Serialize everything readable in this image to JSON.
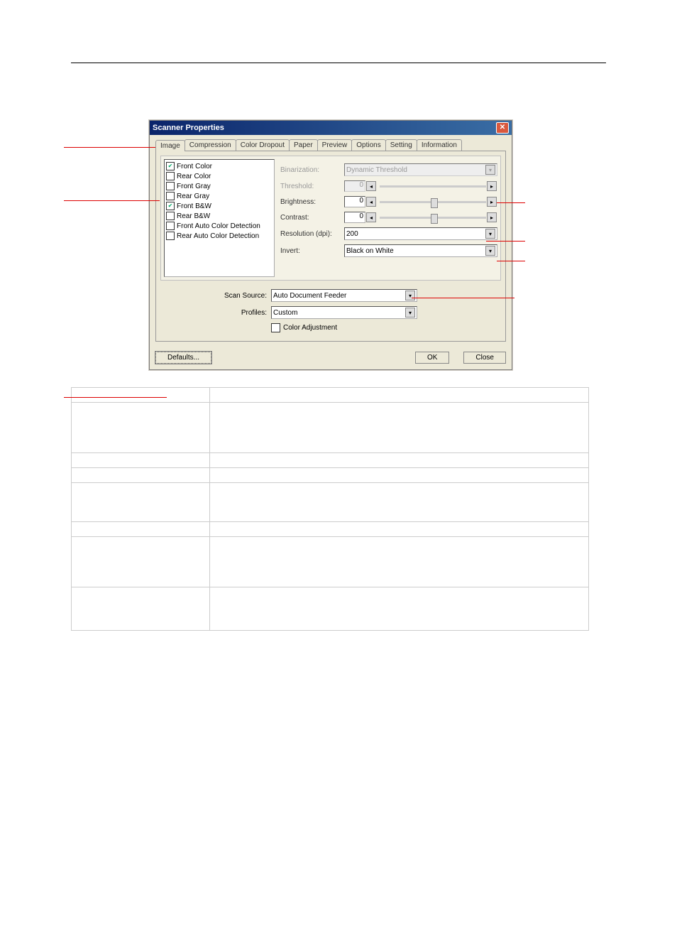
{
  "dialog": {
    "title": "Scanner Properties",
    "tabs": [
      "Image",
      "Compression",
      "Color Dropout",
      "Paper",
      "Preview",
      "Options",
      "Setting",
      "Information"
    ],
    "active_tab": 0,
    "image_list": [
      {
        "label": "Front Color",
        "checked": true
      },
      {
        "label": "Rear Color",
        "checked": false
      },
      {
        "label": "Front Gray",
        "checked": false
      },
      {
        "label": "Rear Gray",
        "checked": false
      },
      {
        "label": "Front B&W",
        "checked": true
      },
      {
        "label": "Rear B&W",
        "checked": false
      },
      {
        "label": "Front Auto Color Detection",
        "checked": false
      },
      {
        "label": "Rear Auto Color Detection",
        "checked": false
      }
    ],
    "settings": {
      "binarization_label": "Binarization:",
      "binarization_value": "Dynamic Threshold",
      "threshold_label": "Threshold:",
      "threshold_value": "0",
      "brightness_label": "Brightness:",
      "brightness_value": "0",
      "contrast_label": "Contrast:",
      "contrast_value": "0",
      "resolution_label": "Resolution (dpi):",
      "resolution_value": "200",
      "invert_label": "Invert:",
      "invert_value": "Black on White"
    },
    "scan_source_label": "Scan Source:",
    "scan_source_value": "Auto Document Feeder",
    "profiles_label": "Profiles:",
    "profiles_value": "Custom",
    "color_adjustment_label": "Color Adjustment",
    "defaults_btn": "Defaults...",
    "ok_btn": "OK",
    "close_btn": "Close"
  },
  "table": [
    {
      "left": "",
      "right": ""
    },
    {
      "left": "",
      "right": ""
    },
    {
      "left": "",
      "right": ""
    },
    {
      "left": "",
      "right": ""
    },
    {
      "left": "",
      "right": ""
    },
    {
      "left": "",
      "right": ""
    },
    {
      "left": "",
      "right": ""
    },
    {
      "left": "",
      "right": ""
    }
  ]
}
